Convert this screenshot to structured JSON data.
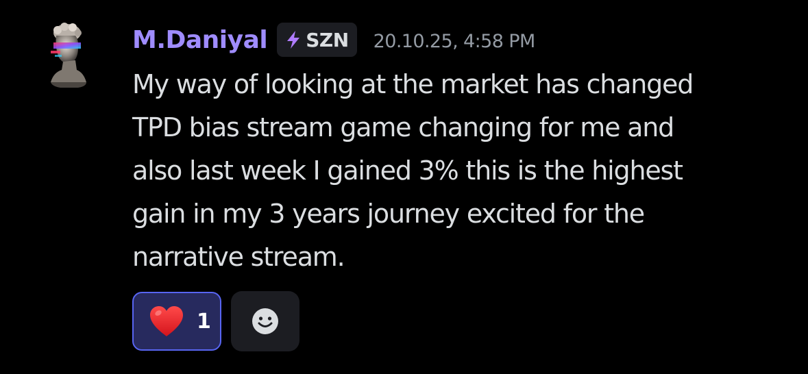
{
  "message": {
    "author": {
      "name": "M.Daniyal",
      "name_color": "#9f8cff",
      "avatar": "statue-bust-avatar"
    },
    "tag": {
      "icon": "lightning-icon",
      "icon_color": "#b07cff",
      "label": "SZN"
    },
    "timestamp": "20.10.25, 4:58 PM",
    "content_lines": [
      "My way of looking at the market has changed",
      "TPD bias stream game changing for me and",
      "also last week I gained 3% this is the highest",
      "gain in my 3 years journey excited for the",
      "narrative stream."
    ]
  },
  "reactions": [
    {
      "emoji": "heart-emoji",
      "count": "1",
      "selected": true
    }
  ],
  "add_reaction": {
    "icon": "smile-icon"
  },
  "colors": {
    "background": "#000000",
    "text": "#dbdee1",
    "timestamp": "#949ba4",
    "reaction_selected_bg": "#272a5e",
    "reaction_selected_border": "#5865f2",
    "chip_bg": "#1c1d22"
  }
}
